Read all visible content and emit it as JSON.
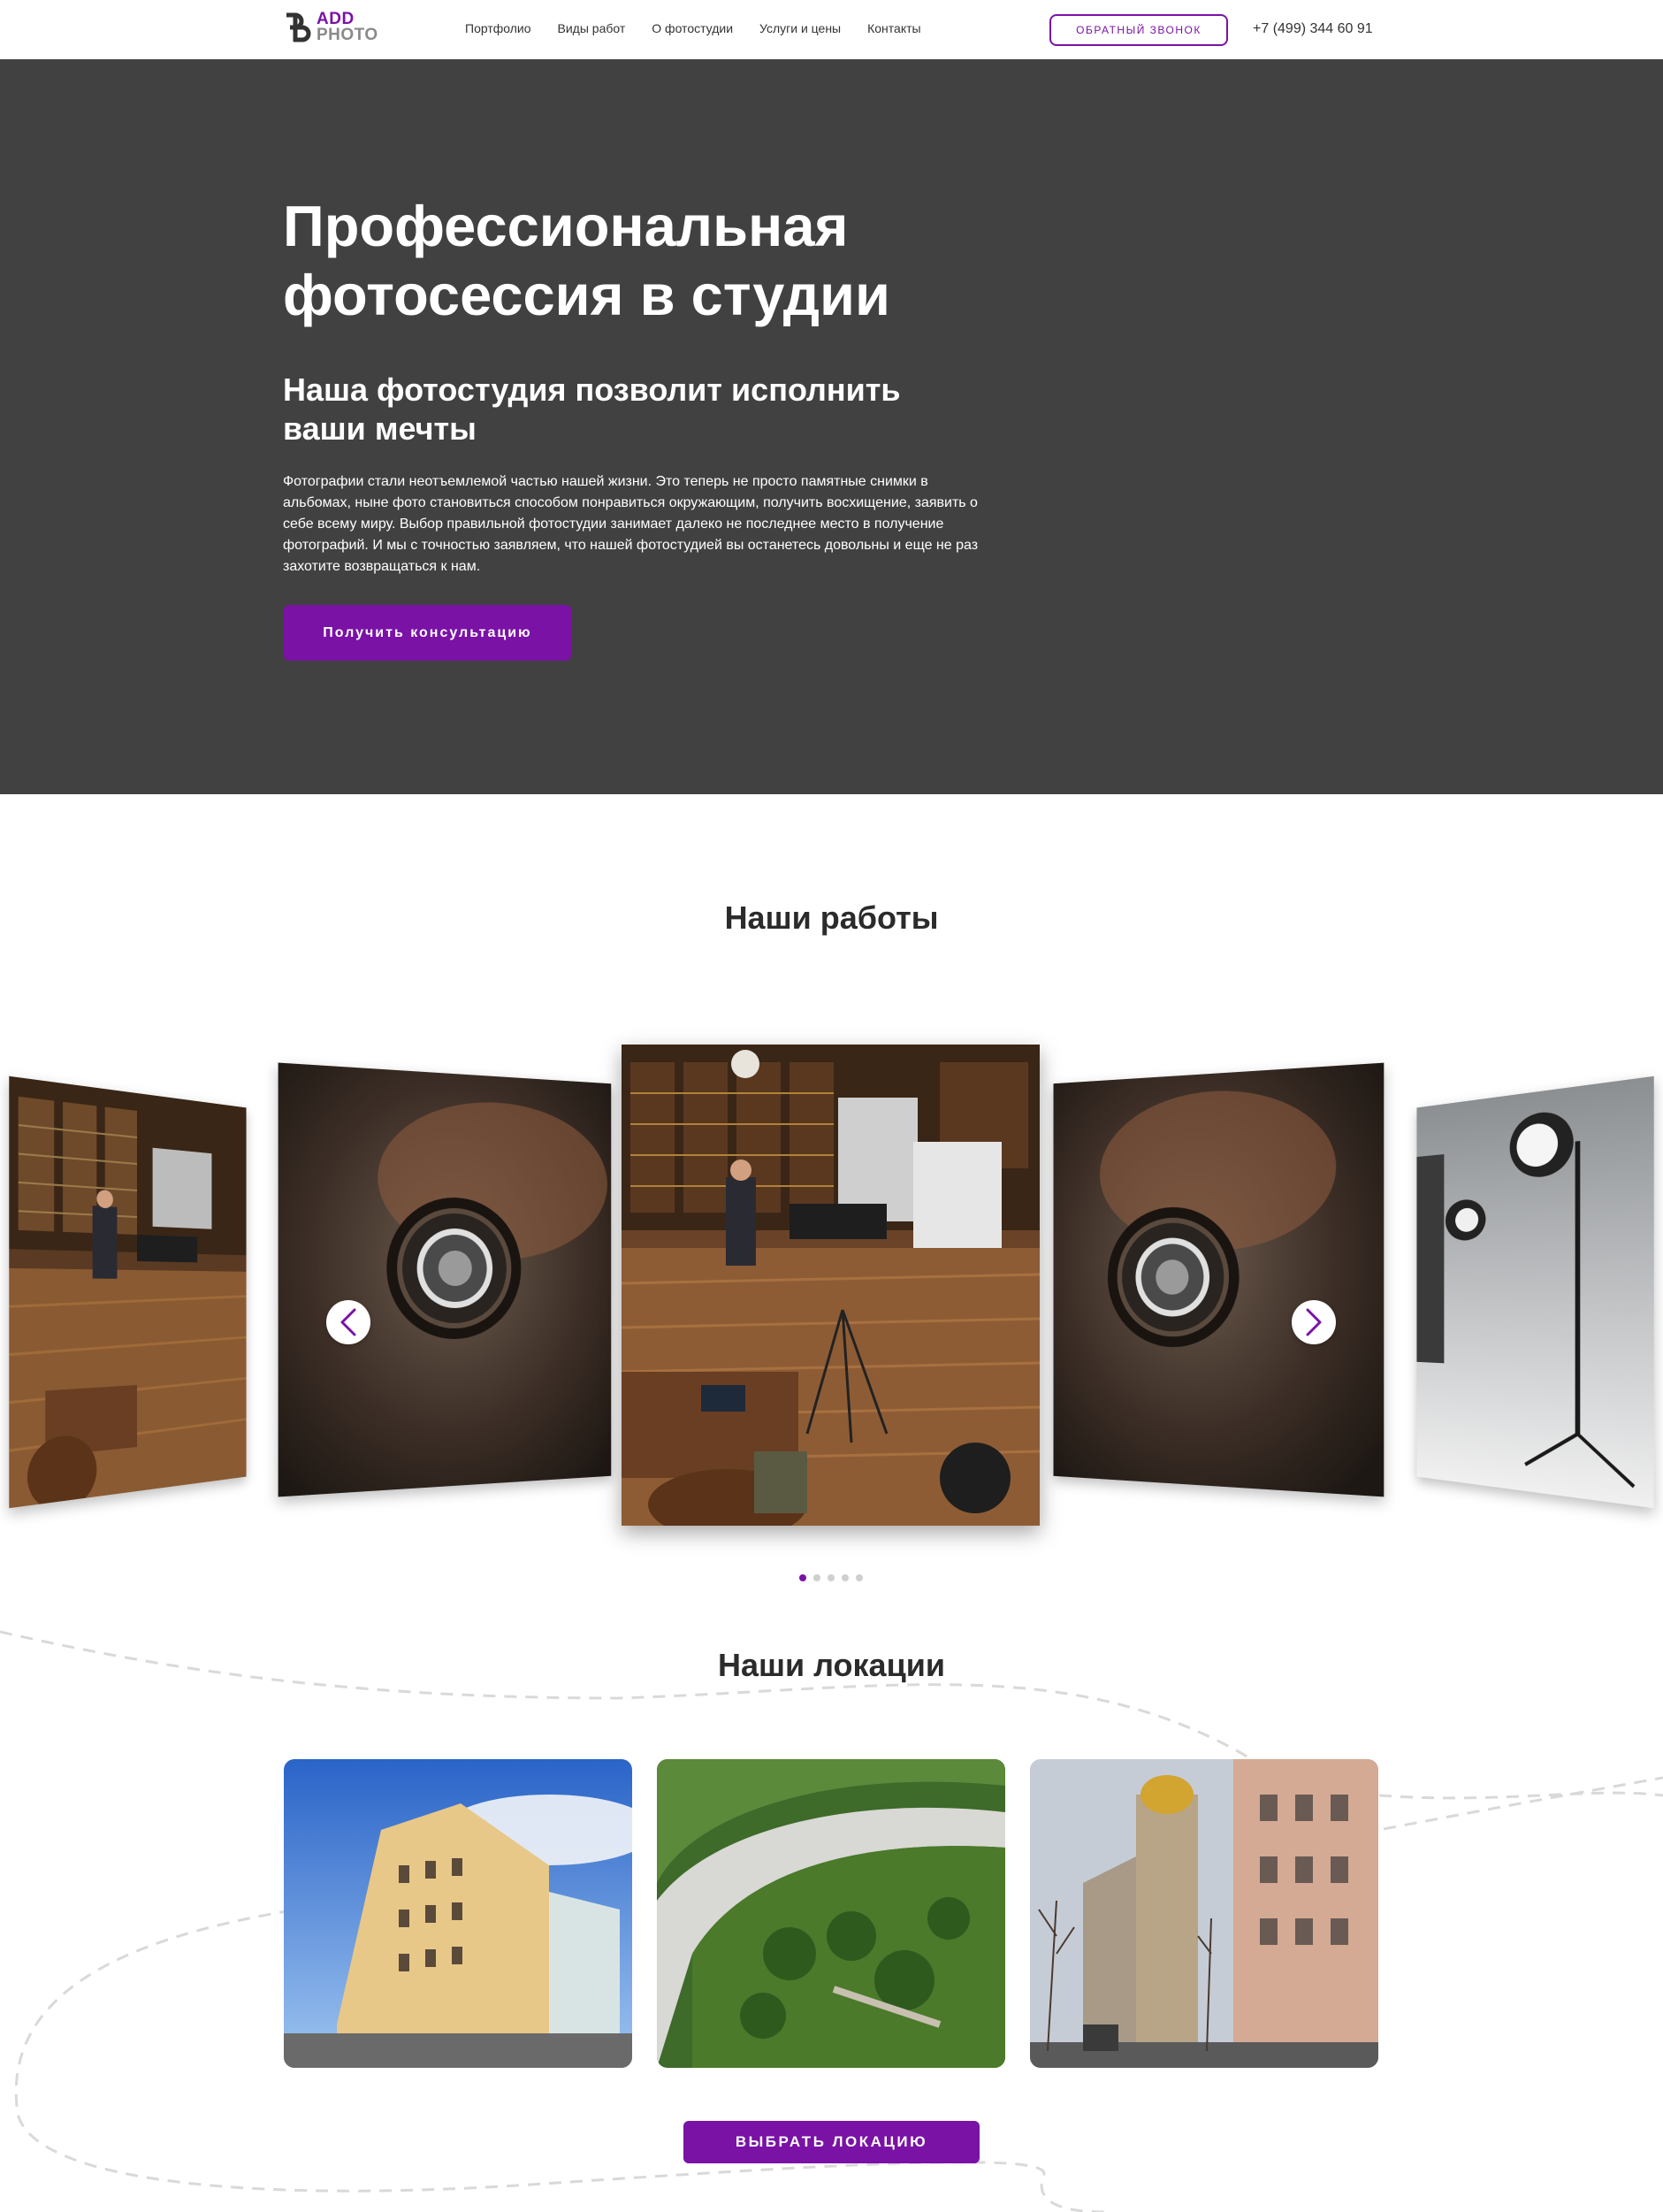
{
  "header": {
    "logo": {
      "line1": "ADD",
      "line2": "PHOTO"
    },
    "nav": [
      "Портфолио",
      "Виды работ",
      "О фотостудии",
      "Услуги и цены",
      "Контакты"
    ],
    "callback_label": "ОБРАТНЫЙ ЗВОНОК",
    "phone": "+7 (499) 344 60 91"
  },
  "hero": {
    "title": "Профессиональная фотосессия в студии",
    "subtitle": "Наша фотостудия позволит исполнить ваши мечты",
    "text": "Фотографии стали неотъемлемой частью нашей жизни. Это теперь не просто памятные снимки в альбомах, ныне фото становиться способом понравиться окружающим, получить восхищение, заявить о себе всему миру. Выбор правильной фотостудии занимает далеко не последнее место в получение фотографий. И мы с точностью заявляем, что нашей фотостудией вы останетесь довольны и еще не раз захотите возвращаться к нам.",
    "button_label": "Получить консультацию"
  },
  "works": {
    "title": "Наши работы",
    "slides": [
      "library-studio-photo",
      "camera-lens-photo",
      "library-studio-photo",
      "camera-lens-photo",
      "studio-lights-photo"
    ],
    "dots_count": 5,
    "active_dot": 0
  },
  "locations": {
    "title": "Наши локации",
    "cards": [
      "apartment-building-photo",
      "aerial-courtyard-photo",
      "street-buildings-photo"
    ],
    "button_label": "ВЫБРАТЬ ЛОКАЦИЮ"
  },
  "colors": {
    "accent": "#7a12a6",
    "hero_bg": "#414141"
  }
}
